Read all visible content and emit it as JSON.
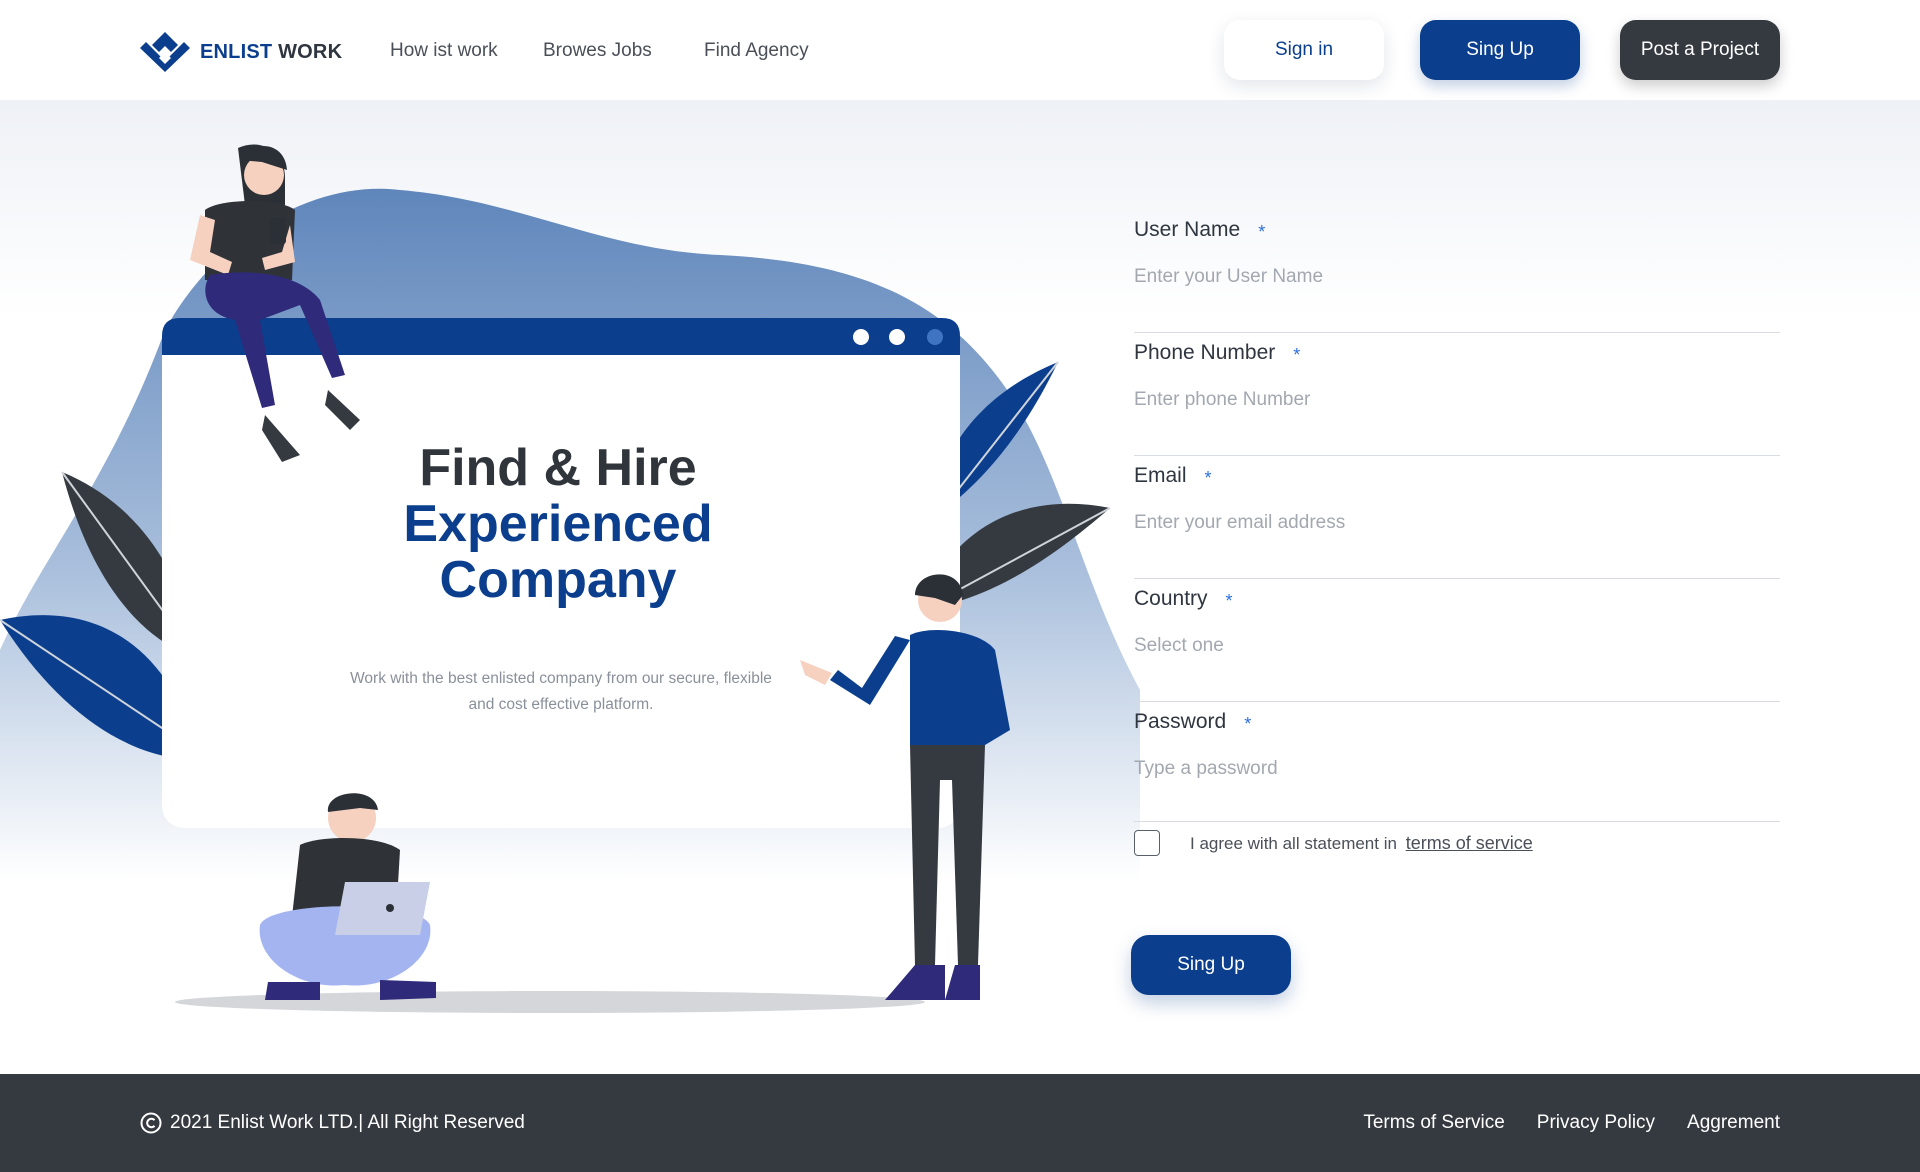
{
  "brand": {
    "name_part1": "ENLIST",
    "name_part2": "WORK",
    "logo_icon": "diamond-logo-icon"
  },
  "nav": {
    "links": [
      "How ist work",
      "Browes Jobs",
      "Find Agency"
    ],
    "sign_in": "Sign in",
    "sign_up": "Sing Up",
    "post_project": "Post a Project"
  },
  "hero": {
    "title_line1": "Find & Hire",
    "title_line2": "Experienced",
    "title_line3": "Company",
    "subtitle_line1": "Work with the best enlisted company from our secure, flexible",
    "subtitle_line2": "and cost effective platform."
  },
  "form": {
    "fields": [
      {
        "label": "User Name",
        "placeholder": "Enter your User Name"
      },
      {
        "label": "Phone Number",
        "placeholder": "Enter phone Number"
      },
      {
        "label": "Email",
        "placeholder": "Enter your email address"
      },
      {
        "label": "Country",
        "placeholder": "Select one"
      },
      {
        "label": "Password",
        "placeholder": "Type a password"
      }
    ],
    "required_mark": "*",
    "agree_text": "I agree with all statement in",
    "agree_link": "terms of service",
    "submit": "Sing Up"
  },
  "footer": {
    "copyright": "2021 Enlist Work LTD.| All Right Reserved",
    "links": [
      "Terms of Service",
      "Privacy Policy",
      "Aggrement"
    ]
  },
  "colors": {
    "primary": "#0b3f8e",
    "dark": "#353a41",
    "blob": "#6f94c4",
    "muted": "#a3a8b0"
  }
}
